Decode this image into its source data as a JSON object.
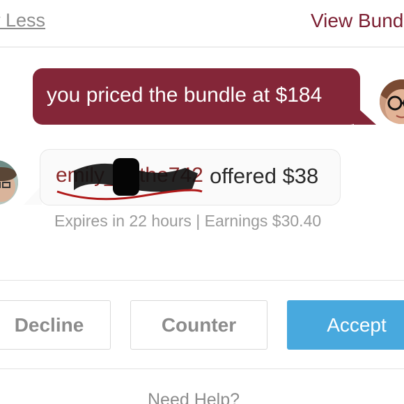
{
  "header": {
    "show_less_label": "ow Less",
    "view_bundle_label": "View Bund"
  },
  "conversation": {
    "seller_message": "you priced the bundle at $184",
    "buyer_username": "emily___the742",
    "buyer_offer_text": "offered $38",
    "offer_meta": "Expires in 22 hours | Earnings $30.40"
  },
  "actions": {
    "decline_label": "Decline",
    "counter_label": "Counter",
    "accept_label": "Accept"
  },
  "footer": {
    "need_help_label": "Need Help?"
  },
  "colors": {
    "brand_maroon": "#842638",
    "accept_blue": "#48a9de",
    "muted_text": "#8c8c8c"
  },
  "icons": {
    "seller_avatar": "seller-avatar-photo",
    "buyer_avatar": "buyer-avatar-photo"
  }
}
